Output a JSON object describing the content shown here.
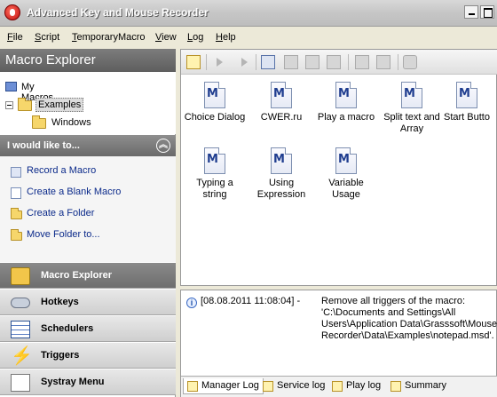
{
  "window": {
    "title": "Advanced Key and Mouse Recorder"
  },
  "menu": [
    {
      "label": "File",
      "u": "F",
      "rest": "ile"
    },
    {
      "label": "Script",
      "u": "S",
      "rest": "cript"
    },
    {
      "label": "TemporaryMacro",
      "u": "T",
      "rest": "emporaryMacro"
    },
    {
      "label": "View",
      "u": "V",
      "rest": "iew"
    },
    {
      "label": "Log",
      "u": "L",
      "rest": "og"
    },
    {
      "label": "Help",
      "u": "H",
      "rest": "elp"
    }
  ],
  "explorer": {
    "header": "Macro Explorer",
    "tree": {
      "root": "My Macros",
      "selected": "Examples",
      "child": "Windows"
    }
  },
  "tasks": {
    "header": "I would like to...",
    "items": [
      {
        "label": "Record a Macro",
        "u": "M"
      },
      {
        "label": "Create a Blank Macro",
        "u": ""
      },
      {
        "label": "Create a Folder",
        "u": ""
      },
      {
        "label": "Move Folder to...",
        "u": ""
      }
    ]
  },
  "nav": [
    {
      "label": "Macro Explorer",
      "icon": "macro-explorer-icon",
      "active": true
    },
    {
      "label": "Hotkeys",
      "icon": "hotkeys-icon",
      "active": false
    },
    {
      "label": "Schedulers",
      "icon": "schedulers-icon",
      "active": false
    },
    {
      "label": "Triggers",
      "icon": "triggers-icon",
      "active": false
    },
    {
      "label": "Systray Menu",
      "icon": "systray-icon",
      "active": false
    }
  ],
  "macros": [
    {
      "line1": "Choice Dialog",
      "line2": ""
    },
    {
      "line1": "CWER.ru",
      "line2": ""
    },
    {
      "line1": "Play a macro",
      "line2": ""
    },
    {
      "line1": "Split text and",
      "line2": "Array"
    },
    {
      "line1": "Start Butto",
      "line2": ""
    },
    {
      "line1": "Typing a",
      "line2": "string"
    },
    {
      "line1": "Using",
      "line2": "Expression"
    },
    {
      "line1": "Variable",
      "line2": "Usage"
    }
  ],
  "macro_icon_letter": "M",
  "log": {
    "time": "[08.08.2011 11:08:04] -",
    "message": "Remove all triggers of the macro: 'C:\\Documents and Settings\\All Users\\Application Data\\Grasssoft\\Mouse Recorder\\Data\\Examples\\notepad.msd'.",
    "tabs": [
      "Manager Log",
      "Service log",
      "Play log",
      "Summary"
    ]
  }
}
